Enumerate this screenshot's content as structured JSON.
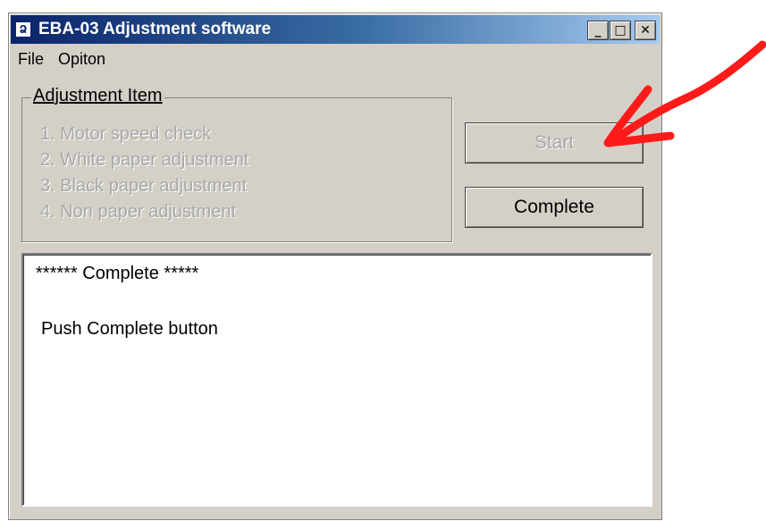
{
  "window": {
    "title": "EBA-03 Adjustment software",
    "icon": "app-icon",
    "controls": {
      "minimize": "_",
      "maximize": "□",
      "close": "✕"
    }
  },
  "menu": {
    "items": [
      "File",
      "Opiton"
    ]
  },
  "adjustment_group": {
    "label": "Adjustment Item",
    "items": [
      "1. Motor speed check",
      "2. White paper adjustment",
      "3. Black paper adjustment",
      "4. Non paper adjustment"
    ]
  },
  "buttons": {
    "start_label": "Start",
    "complete_label": "Complete"
  },
  "output": {
    "line1": "****** Complete *****",
    "line2": "Push Complete button"
  },
  "colors": {
    "annotation_arrow": "#ff1a1a",
    "title_gradient_start": "#0a246a",
    "title_gradient_end": "#a6caf0"
  }
}
